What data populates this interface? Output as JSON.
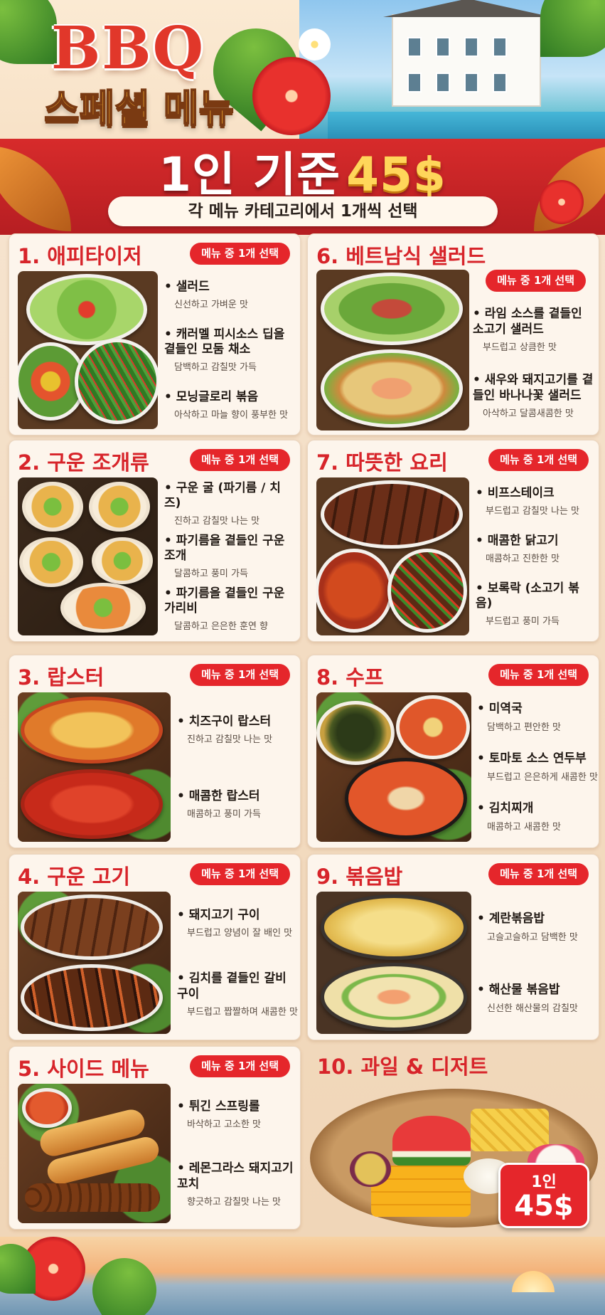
{
  "header": {
    "title_main": "BBQ",
    "title_sub": "스페셜 메뉴",
    "price_prefix": "1인 기준",
    "price_value": "45$",
    "instruction": "각 메뉴 카테고리에서 1개씩 선택"
  },
  "badge_label": "메뉴 중 1개 선택",
  "categories": [
    {
      "title": "1. 애피타이저",
      "items": [
        {
          "name": "샐러드",
          "desc": "신선하고 가벼운 맛"
        },
        {
          "name": "캐러멜 피시소스 딥을 곁들인 모둠 채소",
          "desc": "담백하고 감칠맛 가득"
        },
        {
          "name": "모닝글로리 볶음",
          "desc": "아삭하고 마늘 향이 풍부한 맛"
        }
      ]
    },
    {
      "title": "2. 구운 조개류",
      "items": [
        {
          "name": "구운 굴 (파기름 / 치즈)",
          "desc": "진하고 감칠맛 나는 맛"
        },
        {
          "name": "파기름을 곁들인 구운 조개",
          "desc": "달콤하고 풍미 가득"
        },
        {
          "name": "파기름을 곁들인 구운 가리비",
          "desc": "달콤하고 은은한 훈연 향"
        }
      ]
    },
    {
      "title": "3. 랍스터",
      "items": [
        {
          "name": "치즈구이 랍스터",
          "desc": "진하고 감칠맛 나는 맛"
        },
        {
          "name": "매콤한 랍스터",
          "desc": "매콤하고 풍미 가득"
        }
      ]
    },
    {
      "title": "4. 구운 고기",
      "items": [
        {
          "name": "돼지고기 구이",
          "desc": "부드럽고 양념이 잘 배인 맛"
        },
        {
          "name": "김치를 곁들인 갈비구이",
          "desc": "부드럽고 짭짤하며 새콤한 맛"
        }
      ]
    },
    {
      "title": "5. 사이드 메뉴",
      "items": [
        {
          "name": "튀긴 스프링롤",
          "desc": "바삭하고 고소한 맛"
        },
        {
          "name": "레몬그라스 돼지고기 꼬치",
          "desc": "향긋하고 감칠맛 나는 맛"
        }
      ]
    },
    {
      "title": "6. 베트남식 샐러드",
      "items": [
        {
          "name": "라임 소스를 곁들인 소고기 샐러드",
          "desc": "부드럽고 상큼한 맛"
        },
        {
          "name": "새우와 돼지고기를 곁들인 바나나꽃 샐러드",
          "desc": "아삭하고 달콤새콤한 맛"
        }
      ]
    },
    {
      "title": "7. 따뜻한 요리",
      "items": [
        {
          "name": "비프스테이크",
          "desc": "부드럽고 감칠맛 나는 맛"
        },
        {
          "name": "매콤한 닭고기",
          "desc": "매콤하고 진한한 맛"
        },
        {
          "name": "보록락 (소고기 볶음)",
          "desc": "부드럽고 풍미 가득"
        }
      ]
    },
    {
      "title": "8. 수프",
      "items": [
        {
          "name": "미역국",
          "desc": "담백하고 편안한 맛"
        },
        {
          "name": "토마토 소스 연두부",
          "desc": "부드럽고 은은하게 새콤한 맛"
        },
        {
          "name": "김치찌개",
          "desc": "매콤하고 새콤한 맛"
        }
      ]
    },
    {
      "title": "9. 볶음밥",
      "items": [
        {
          "name": "계란볶음밥",
          "desc": "고슬고슬하고 담백한 맛"
        },
        {
          "name": "해산물 볶음밥",
          "desc": "신선한 해산물의 감칠맛"
        }
      ]
    }
  ],
  "dessert": {
    "title": "10. 과일 & 디저트",
    "price_line1": "1인",
    "price_line2": "45$"
  },
  "colors": {
    "accent": "#e5262b",
    "title_red": "#d7242a",
    "gold": "#ffd65a",
    "card_bg": "#fdf5ec"
  }
}
